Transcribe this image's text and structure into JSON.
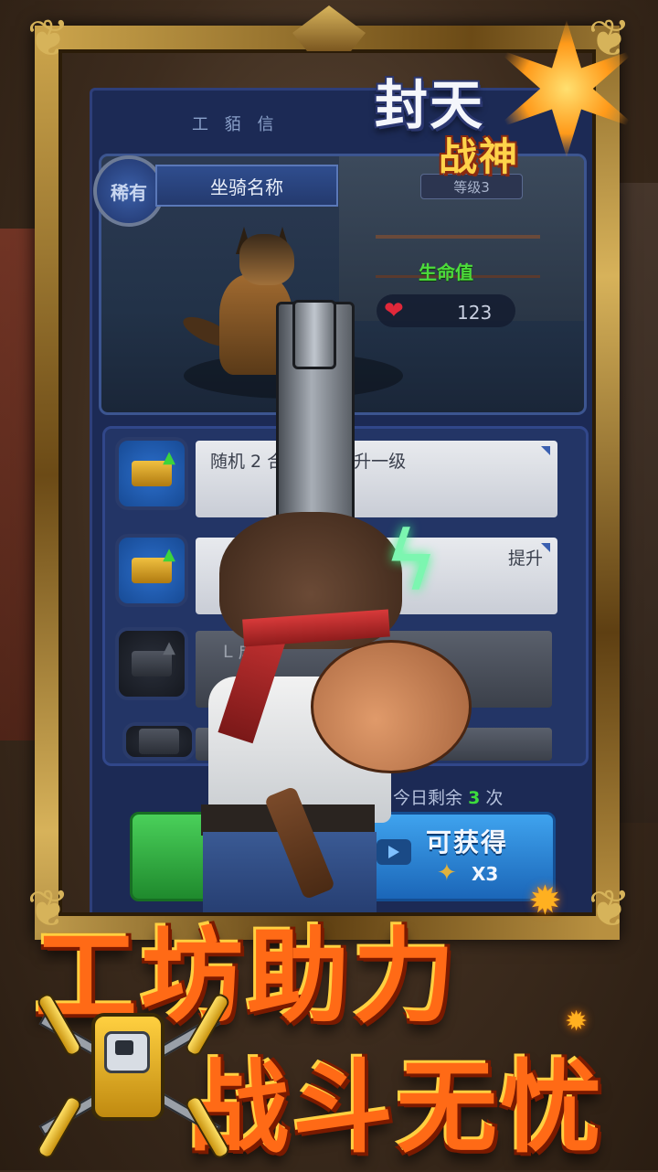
{
  "logo": {
    "line1": "封天",
    "line2": "战神"
  },
  "panel": {
    "title": "工 貊 信"
  },
  "mount": {
    "rarity": "稀有",
    "name": "坐骑名称",
    "level": "等级3",
    "stat_label": "生命值",
    "stat_icon": "heart-icon",
    "stat_value": "123"
  },
  "upgrades": [
    {
      "text": "随机 2 合成等级提升一级",
      "locked": false,
      "icon": "pistol-upgrade-icon"
    },
    {
      "text": "提升",
      "locked": false,
      "icon": "pistol-upgrade-icon"
    },
    {
      "text": "L 成 级",
      "locked": true,
      "icon": "locked-pistol-icon"
    },
    {
      "text": "",
      "locked": true,
      "icon": "locked-pistol-icon"
    }
  ],
  "remaining": {
    "prefix": "今日剩余",
    "count": "3",
    "suffix": "次"
  },
  "buttons": {
    "reward_label": "可获得",
    "reward_count": "X3",
    "reward_icon": "puzzle-piece-icon",
    "video_icon": "video-play-icon"
  },
  "headline": {
    "line1": "工坊助力",
    "line2": "战斗无忧"
  },
  "colors": {
    "accent_orange": "#ff6a16",
    "stat_green": "#4ddb3c",
    "panel_blue": "#1c2a55",
    "frame_gold": "#c9a24a"
  }
}
